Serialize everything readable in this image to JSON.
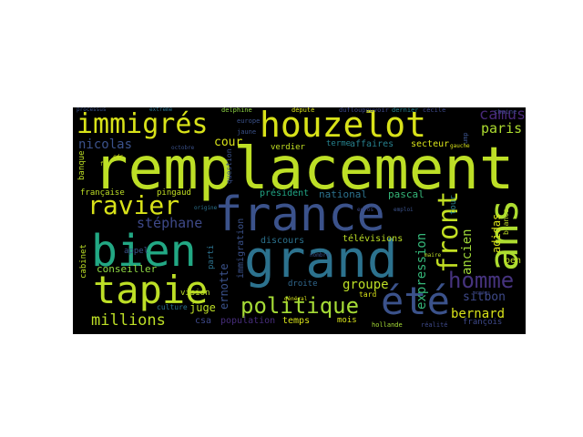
{
  "wordcloud": {
    "words": [
      {
        "text": "remplacement",
        "color": "#bddf26"
      },
      {
        "text": "grand",
        "color": "#2c728e"
      },
      {
        "text": "france",
        "color": "#3b528b"
      },
      {
        "text": "houzelot",
        "color": "#d8e219"
      },
      {
        "text": "immigrés",
        "color": "#d8e219"
      },
      {
        "text": "bien",
        "color": "#22a884"
      },
      {
        "text": "tapie",
        "color": "#bddf26"
      },
      {
        "text": "ans",
        "color": "#addc30"
      },
      {
        "text": "été",
        "color": "#3b528b"
      },
      {
        "text": "politique",
        "color": "#a5db36"
      },
      {
        "text": "ravier",
        "color": "#d8e219"
      },
      {
        "text": "homme",
        "color": "#46337e"
      },
      {
        "text": "front",
        "color": "#c2df23"
      },
      {
        "text": "camus",
        "color": "#482878"
      },
      {
        "text": "paris",
        "color": "#addc30"
      },
      {
        "text": "nicolas",
        "color": "#3b528b"
      },
      {
        "text": "cour",
        "color": "#d8e219"
      },
      {
        "text": "stéphane",
        "color": "#3e4989"
      },
      {
        "text": "millions",
        "color": "#bddf26"
      },
      {
        "text": "bernard",
        "color": "#d8e219"
      },
      {
        "text": "expression",
        "color": "#35b779"
      },
      {
        "text": "ancien",
        "color": "#a0da39"
      },
      {
        "text": "groupe",
        "color": "#bddf26"
      },
      {
        "text": "sitbon",
        "color": "#3e4989"
      },
      {
        "text": "adidas",
        "color": "#d8e219"
      },
      {
        "text": "conseiller",
        "color": "#8fd744"
      },
      {
        "text": "juge",
        "color": "#bddf26"
      },
      {
        "text": "pascal",
        "color": "#35b779"
      },
      {
        "text": "national",
        "color": "#2c728e"
      },
      {
        "text": "président",
        "color": "#21a585"
      },
      {
        "text": "secteur",
        "color": "#d8e219"
      },
      {
        "text": "affaires",
        "color": "#27808e"
      },
      {
        "text": "terme",
        "color": "#26828e"
      },
      {
        "text": "verdier",
        "color": "#c2df23"
      },
      {
        "text": "française",
        "color": "#bddf26"
      },
      {
        "text": "pingaud",
        "color": "#c2df23"
      },
      {
        "text": "appel",
        "color": "#3b528b"
      },
      {
        "text": "télévisions",
        "color": "#bddf26"
      },
      {
        "text": "discours",
        "color": "#2c728e"
      },
      {
        "text": "ernotte",
        "color": "#3b528b"
      },
      {
        "text": "droite",
        "color": "#31688e"
      },
      {
        "text": "parti",
        "color": "#2c728e"
      },
      {
        "text": "vision",
        "color": "#bddf26"
      },
      {
        "text": "population",
        "color": "#472d7b"
      },
      {
        "text": "temps",
        "color": "#d8e219"
      },
      {
        "text": "mois",
        "color": "#d8e219"
      },
      {
        "text": "csa",
        "color": "#3e4989"
      },
      {
        "text": "culture",
        "color": "#2c728e"
      },
      {
        "text": "immigration",
        "color": "#3b528b"
      },
      {
        "text": "cabinet",
        "color": "#bddf26"
      },
      {
        "text": "banque",
        "color": "#bddf26"
      },
      {
        "text": "françois",
        "color": "#3e4989"
      },
      {
        "text": "pen",
        "color": "#c2df23"
      },
      {
        "text": "chaine",
        "color": "#3e4989"
      },
      {
        "text": "tour",
        "color": "#27808e"
      },
      {
        "text": "blancs",
        "color": "#bddf26"
      },
      {
        "text": "hollande",
        "color": "#a5db36"
      },
      {
        "text": "réalité",
        "color": "#3e4989"
      },
      {
        "text": "tard",
        "color": "#d8e219"
      },
      {
        "text": "question",
        "color": "#3b528b"
      },
      {
        "text": "europe",
        "color": "#3b528b"
      },
      {
        "text": "jaune",
        "color": "#3b528b"
      },
      {
        "text": "delphine",
        "color": "#8fd744"
      },
      {
        "text": "député",
        "color": "#d8e219"
      },
      {
        "text": "dufloupouvoir",
        "color": "#3e4989"
      },
      {
        "text": "dernier",
        "color": "#27808e"
      },
      {
        "text": "cécile",
        "color": "#3e4989"
      },
      {
        "text": "processus",
        "color": "#3b528b"
      },
      {
        "text": "extrême",
        "color": "#2c728e"
      },
      {
        "text": "octobre",
        "color": "#3b528b"
      },
      {
        "text": "fin",
        "color": "#c2df23"
      },
      {
        "text": "cdr",
        "color": "#d8e219"
      },
      {
        "text": "années",
        "color": "#3e4989"
      },
      {
        "text": "gauche",
        "color": "#d8e219"
      },
      {
        "text": "ump",
        "color": "#3b528b"
      },
      {
        "text": "origine",
        "color": "#2c728e"
      },
      {
        "text": "général",
        "color": "#d8e219"
      },
      {
        "text": "maire",
        "color": "#bddf26"
      },
      {
        "text": "nombre",
        "color": "#3b528b"
      },
      {
        "text": "euros",
        "color": "#3e4989"
      },
      {
        "text": "emploi",
        "color": "#3b528b"
      }
    ]
  }
}
